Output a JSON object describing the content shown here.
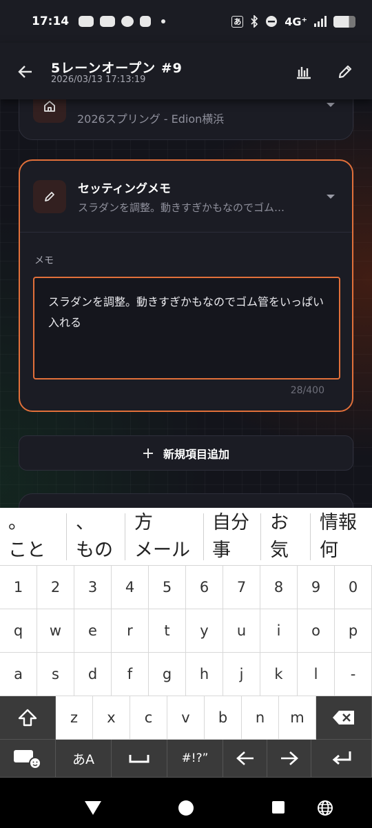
{
  "status_bar": {
    "time": "17:14",
    "input_mode": "あ",
    "network": "4G⁺",
    "icons": [
      "discord-icon",
      "discord-icon",
      "chat-bubble-icon",
      "app-icon",
      "dot-icon",
      "bluetooth-icon",
      "dnd-icon",
      "signal-icon",
      "battery-icon"
    ]
  },
  "app_bar": {
    "title": "5レーンオープン #9",
    "timestamp": "2026/03/13 17:13:19"
  },
  "event_card": {
    "subtext": "2026スプリング - Edion横浜",
    "icon": "home-icon"
  },
  "memo_card": {
    "title": "セッティングメモ",
    "preview": "スラダンを調整。動きすぎかもなのでゴム…",
    "field_label": "メモ",
    "value": "スラダンを調整。動きすぎかもなのでゴム管をいっぱい入れる",
    "counter": "28/400",
    "icon": "pencil-icon"
  },
  "add_item": {
    "label": "新規項目追加"
  },
  "keyboard": {
    "candidates": [
      {
        "top": "。",
        "bottom": "こと"
      },
      {
        "top": "、",
        "bottom": "もの"
      },
      {
        "top": "方",
        "bottom": "メール"
      },
      {
        "top": "自分",
        "bottom": "事"
      },
      {
        "top": "お",
        "bottom": "気"
      },
      {
        "top": "情報",
        "bottom": "何"
      }
    ],
    "row_numbers": [
      "1",
      "2",
      "3",
      "4",
      "5",
      "6",
      "7",
      "8",
      "9",
      "0"
    ],
    "row_q": [
      "q",
      "w",
      "e",
      "r",
      "t",
      "y",
      "u",
      "i",
      "o",
      "p"
    ],
    "row_a": [
      "a",
      "s",
      "d",
      "f",
      "g",
      "h",
      "j",
      "k",
      "l",
      "-"
    ],
    "row_z": [
      "z",
      "x",
      "c",
      "v",
      "b",
      "n",
      "m"
    ],
    "kana_key": "あA",
    "symbols_key": "#!?”"
  },
  "colors": {
    "accent": "#e2703a",
    "card_bg": "#1b1c24",
    "app_bar_bg": "#1b1c23"
  }
}
